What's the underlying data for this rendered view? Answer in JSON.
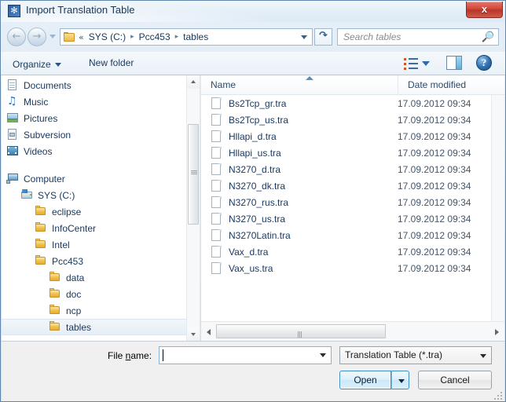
{
  "window": {
    "title": "Import Translation Table",
    "app_icon": "application-icon",
    "close_label": "x"
  },
  "navbar": {
    "back_icon": "back-arrow-icon",
    "forward_icon": "forward-arrow-icon",
    "recent_dropdown_icon": "chevron-down-icon",
    "folder_icon": "folder-icon",
    "breadcrumb_prefix": "«",
    "breadcrumbs": [
      {
        "label": "SYS (C:)"
      },
      {
        "label": "Pcc453"
      },
      {
        "label": "tables"
      }
    ],
    "breadcrumb_separator": "▸",
    "address_dropdown_icon": "chevron-down-icon",
    "refresh_icon": "refresh-icon",
    "search_placeholder": "Search tables",
    "search_value": "",
    "search_icon": "search-icon"
  },
  "toolbar": {
    "organize_label": "Organize",
    "organize_caret_icon": "chevron-down-icon",
    "new_folder_label": "New folder",
    "view_icon": "view-list-icon",
    "view_caret_icon": "chevron-down-icon",
    "preview_pane_icon": "preview-pane-icon",
    "help_icon": "help-icon",
    "help_glyph": "?"
  },
  "nav_pane": {
    "items": [
      {
        "label": "Documents",
        "icon": "documents-icon",
        "type": "doc",
        "indent": 0,
        "selected": false
      },
      {
        "label": "Music",
        "icon": "music-icon",
        "type": "music",
        "indent": 0,
        "selected": false
      },
      {
        "label": "Pictures",
        "icon": "pictures-icon",
        "type": "pic",
        "indent": 0,
        "selected": false
      },
      {
        "label": "Subversion",
        "icon": "subversion-icon",
        "type": "sub",
        "indent": 0,
        "selected": false
      },
      {
        "label": "Videos",
        "icon": "videos-icon",
        "type": "video",
        "indent": 0,
        "selected": false
      },
      {
        "label": "",
        "icon": "spacer",
        "type": "spacer",
        "indent": 0,
        "selected": false
      },
      {
        "label": "Computer",
        "icon": "computer-icon",
        "type": "computer",
        "indent": 0,
        "selected": false
      },
      {
        "label": "SYS (C:)",
        "icon": "drive-icon",
        "type": "drive",
        "indent": 1,
        "selected": false
      },
      {
        "label": "eclipse",
        "icon": "folder-icon",
        "type": "folder",
        "indent": 2,
        "selected": false
      },
      {
        "label": "InfoCenter",
        "icon": "folder-icon",
        "type": "folder",
        "indent": 2,
        "selected": false
      },
      {
        "label": "Intel",
        "icon": "folder-icon",
        "type": "folder",
        "indent": 2,
        "selected": false
      },
      {
        "label": "Pcc453",
        "icon": "folder-icon",
        "type": "folder",
        "indent": 2,
        "selected": false
      },
      {
        "label": "data",
        "icon": "folder-icon",
        "type": "folder",
        "indent": 3,
        "selected": false
      },
      {
        "label": "doc",
        "icon": "folder-icon",
        "type": "folder",
        "indent": 3,
        "selected": false
      },
      {
        "label": "ncp",
        "icon": "folder-icon",
        "type": "folder",
        "indent": 3,
        "selected": false
      },
      {
        "label": "tables",
        "icon": "folder-icon",
        "type": "folder",
        "indent": 3,
        "selected": true
      }
    ],
    "scroll_up_icon": "scroll-up-arrow-icon",
    "scroll_down_icon": "scroll-down-arrow-icon"
  },
  "file_list": {
    "columns": [
      {
        "key": "name",
        "label": "Name",
        "sorted": true,
        "sort_direction": "asc"
      },
      {
        "key": "date",
        "label": "Date modified",
        "sorted": false,
        "sort_direction": ""
      }
    ],
    "rows": [
      {
        "name": "Bs2Tcp_gr.tra",
        "date": "17.09.2012 09:34",
        "icon": "file-icon"
      },
      {
        "name": "Bs2Tcp_us.tra",
        "date": "17.09.2012 09:34",
        "icon": "file-icon"
      },
      {
        "name": "Hllapi_d.tra",
        "date": "17.09.2012 09:34",
        "icon": "file-icon"
      },
      {
        "name": "Hllapi_us.tra",
        "date": "17.09.2012 09:34",
        "icon": "file-icon"
      },
      {
        "name": "N3270_d.tra",
        "date": "17.09.2012 09:34",
        "icon": "file-icon"
      },
      {
        "name": "N3270_dk.tra",
        "date": "17.09.2012 09:34",
        "icon": "file-icon"
      },
      {
        "name": "N3270_rus.tra",
        "date": "17.09.2012 09:34",
        "icon": "file-icon"
      },
      {
        "name": "N3270_us.tra",
        "date": "17.09.2012 09:34",
        "icon": "file-icon"
      },
      {
        "name": "N3270Latin.tra",
        "date": "17.09.2012 09:34",
        "icon": "file-icon"
      },
      {
        "name": "Vax_d.tra",
        "date": "17.09.2012 09:34",
        "icon": "file-icon"
      },
      {
        "name": "Vax_us.tra",
        "date": "17.09.2012 09:34",
        "icon": "file-icon"
      }
    ],
    "hscroll_left_icon": "scroll-left-arrow-icon",
    "hscroll_right_icon": "scroll-right-arrow-icon"
  },
  "footer": {
    "filename_label_pre": "File ",
    "filename_label_key": "n",
    "filename_label_post": "ame:",
    "filename_value": "",
    "filename_placeholder": "",
    "filename_dropdown_icon": "chevron-down-icon",
    "filetype_value": "Translation Table (*.tra)",
    "filetype_dropdown_icon": "chevron-down-icon",
    "open_label": "Open",
    "open_split_icon": "chevron-down-icon",
    "cancel_label": "Cancel",
    "resize_grip_icon": "resize-grip-icon"
  },
  "colors": {
    "accent": "#3c8fc4",
    "title_text": "#1b3655",
    "link_text": "#17375e",
    "close_red": "#d14a3c",
    "folder_yellow": "#f0bf49",
    "panel_bg": "#f0f0f0"
  }
}
